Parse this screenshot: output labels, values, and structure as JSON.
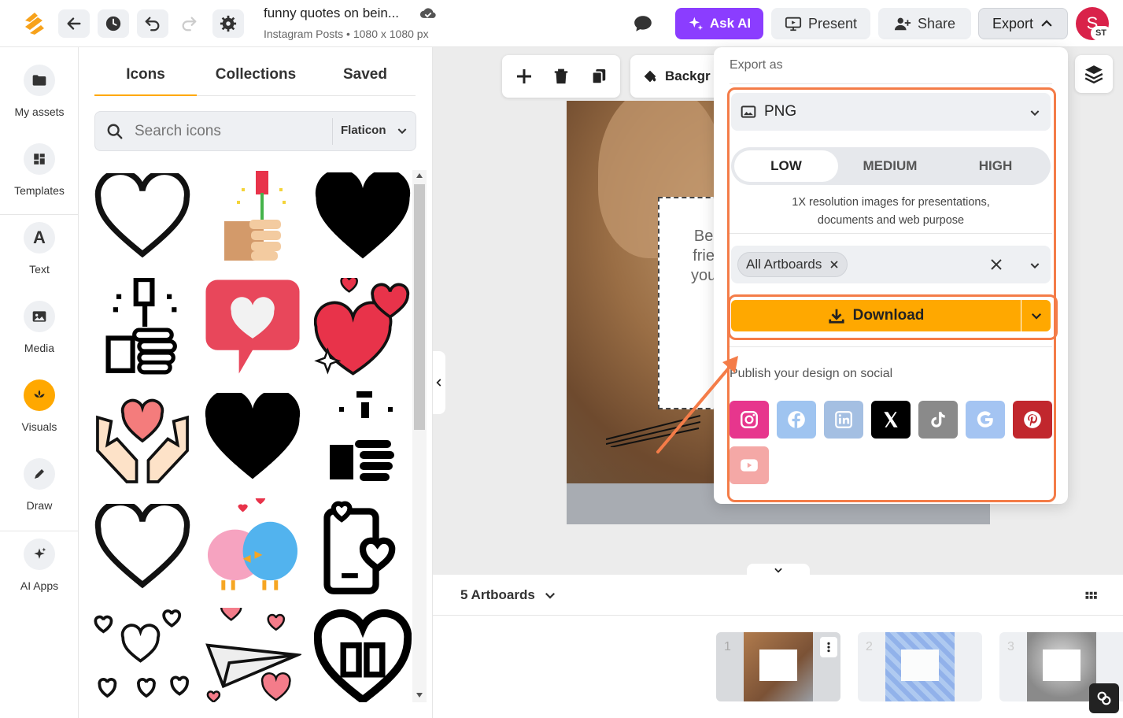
{
  "header": {
    "doc_title": "funny quotes on bein...",
    "doc_subtitle": "Instagram Posts • 1080 x 1080 px",
    "ask_ai": "Ask AI",
    "present": "Present",
    "share": "Share",
    "export": "Export",
    "avatar_letter": "S",
    "avatar_initials": "ST"
  },
  "rail": {
    "items": [
      {
        "label": "My assets",
        "icon": "folder-icon"
      },
      {
        "label": "Templates",
        "icon": "templates-icon"
      },
      {
        "label": "Text",
        "icon": "text-icon"
      },
      {
        "label": "Media",
        "icon": "image-icon"
      },
      {
        "label": "Visuals",
        "icon": "visuals-icon"
      },
      {
        "label": "Draw",
        "icon": "pen-icon"
      },
      {
        "label": "AI Apps",
        "icon": "sparkle-icon"
      }
    ]
  },
  "panel": {
    "tabs": [
      "Icons",
      "Collections",
      "Saved"
    ],
    "search_placeholder": "Search icons",
    "source": "Flaticon"
  },
  "canvas": {
    "toolbar_background": "Backgr",
    "text_snippet": [
      "Be",
      "frie",
      "you"
    ]
  },
  "export": {
    "title": "Export as",
    "format": "PNG",
    "qualities": [
      "LOW",
      "MEDIUM",
      "HIGH"
    ],
    "selected_quality": "LOW",
    "quality_desc_1": "1X resolution images for presentations,",
    "quality_desc_2": "documents and web purpose",
    "artboards_chip": "All Artboards",
    "download": "Download",
    "publish_title": "Publish your design on social"
  },
  "bottom": {
    "artboards_label": "5 Artboards",
    "thumb_numbers": [
      "1",
      "2",
      "3"
    ]
  },
  "colors": {
    "accent_orange": "#ffa800",
    "ask_ai_purple": "#8b3dff",
    "highlight": "#f47c48",
    "avatar": "#d9224a"
  }
}
